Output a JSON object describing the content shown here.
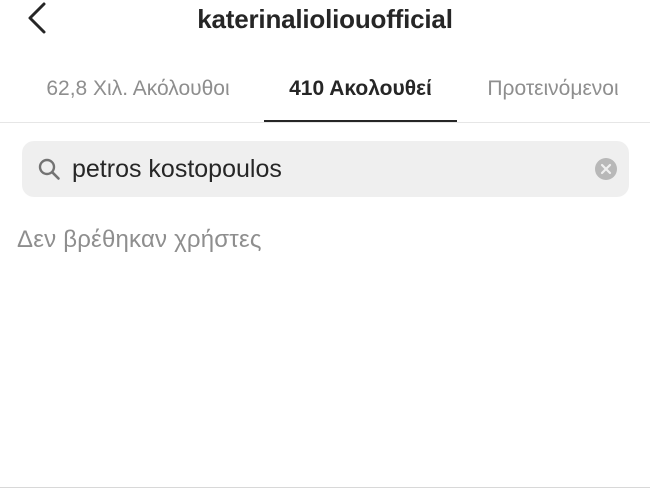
{
  "header": {
    "title": "katerinalioliouofficial",
    "back_icon": "chevron-left-icon"
  },
  "tabs": [
    {
      "label": "62,8 Χιλ. Ακόλουθοι",
      "active": false
    },
    {
      "label": "410 Ακολουθεί",
      "active": true
    },
    {
      "label": "Προτεινόμενοι",
      "active": false
    }
  ],
  "search": {
    "value": "petros kostopoulos",
    "icon": "search-icon",
    "clear_icon": "clear-icon"
  },
  "results": {
    "empty_message": "Δεν βρέθηκαν χρήστες"
  },
  "colors": {
    "text_primary": "#262626",
    "text_secondary": "#8e8e8e",
    "search_bg": "#efefef",
    "divider": "#e6e6e6"
  }
}
